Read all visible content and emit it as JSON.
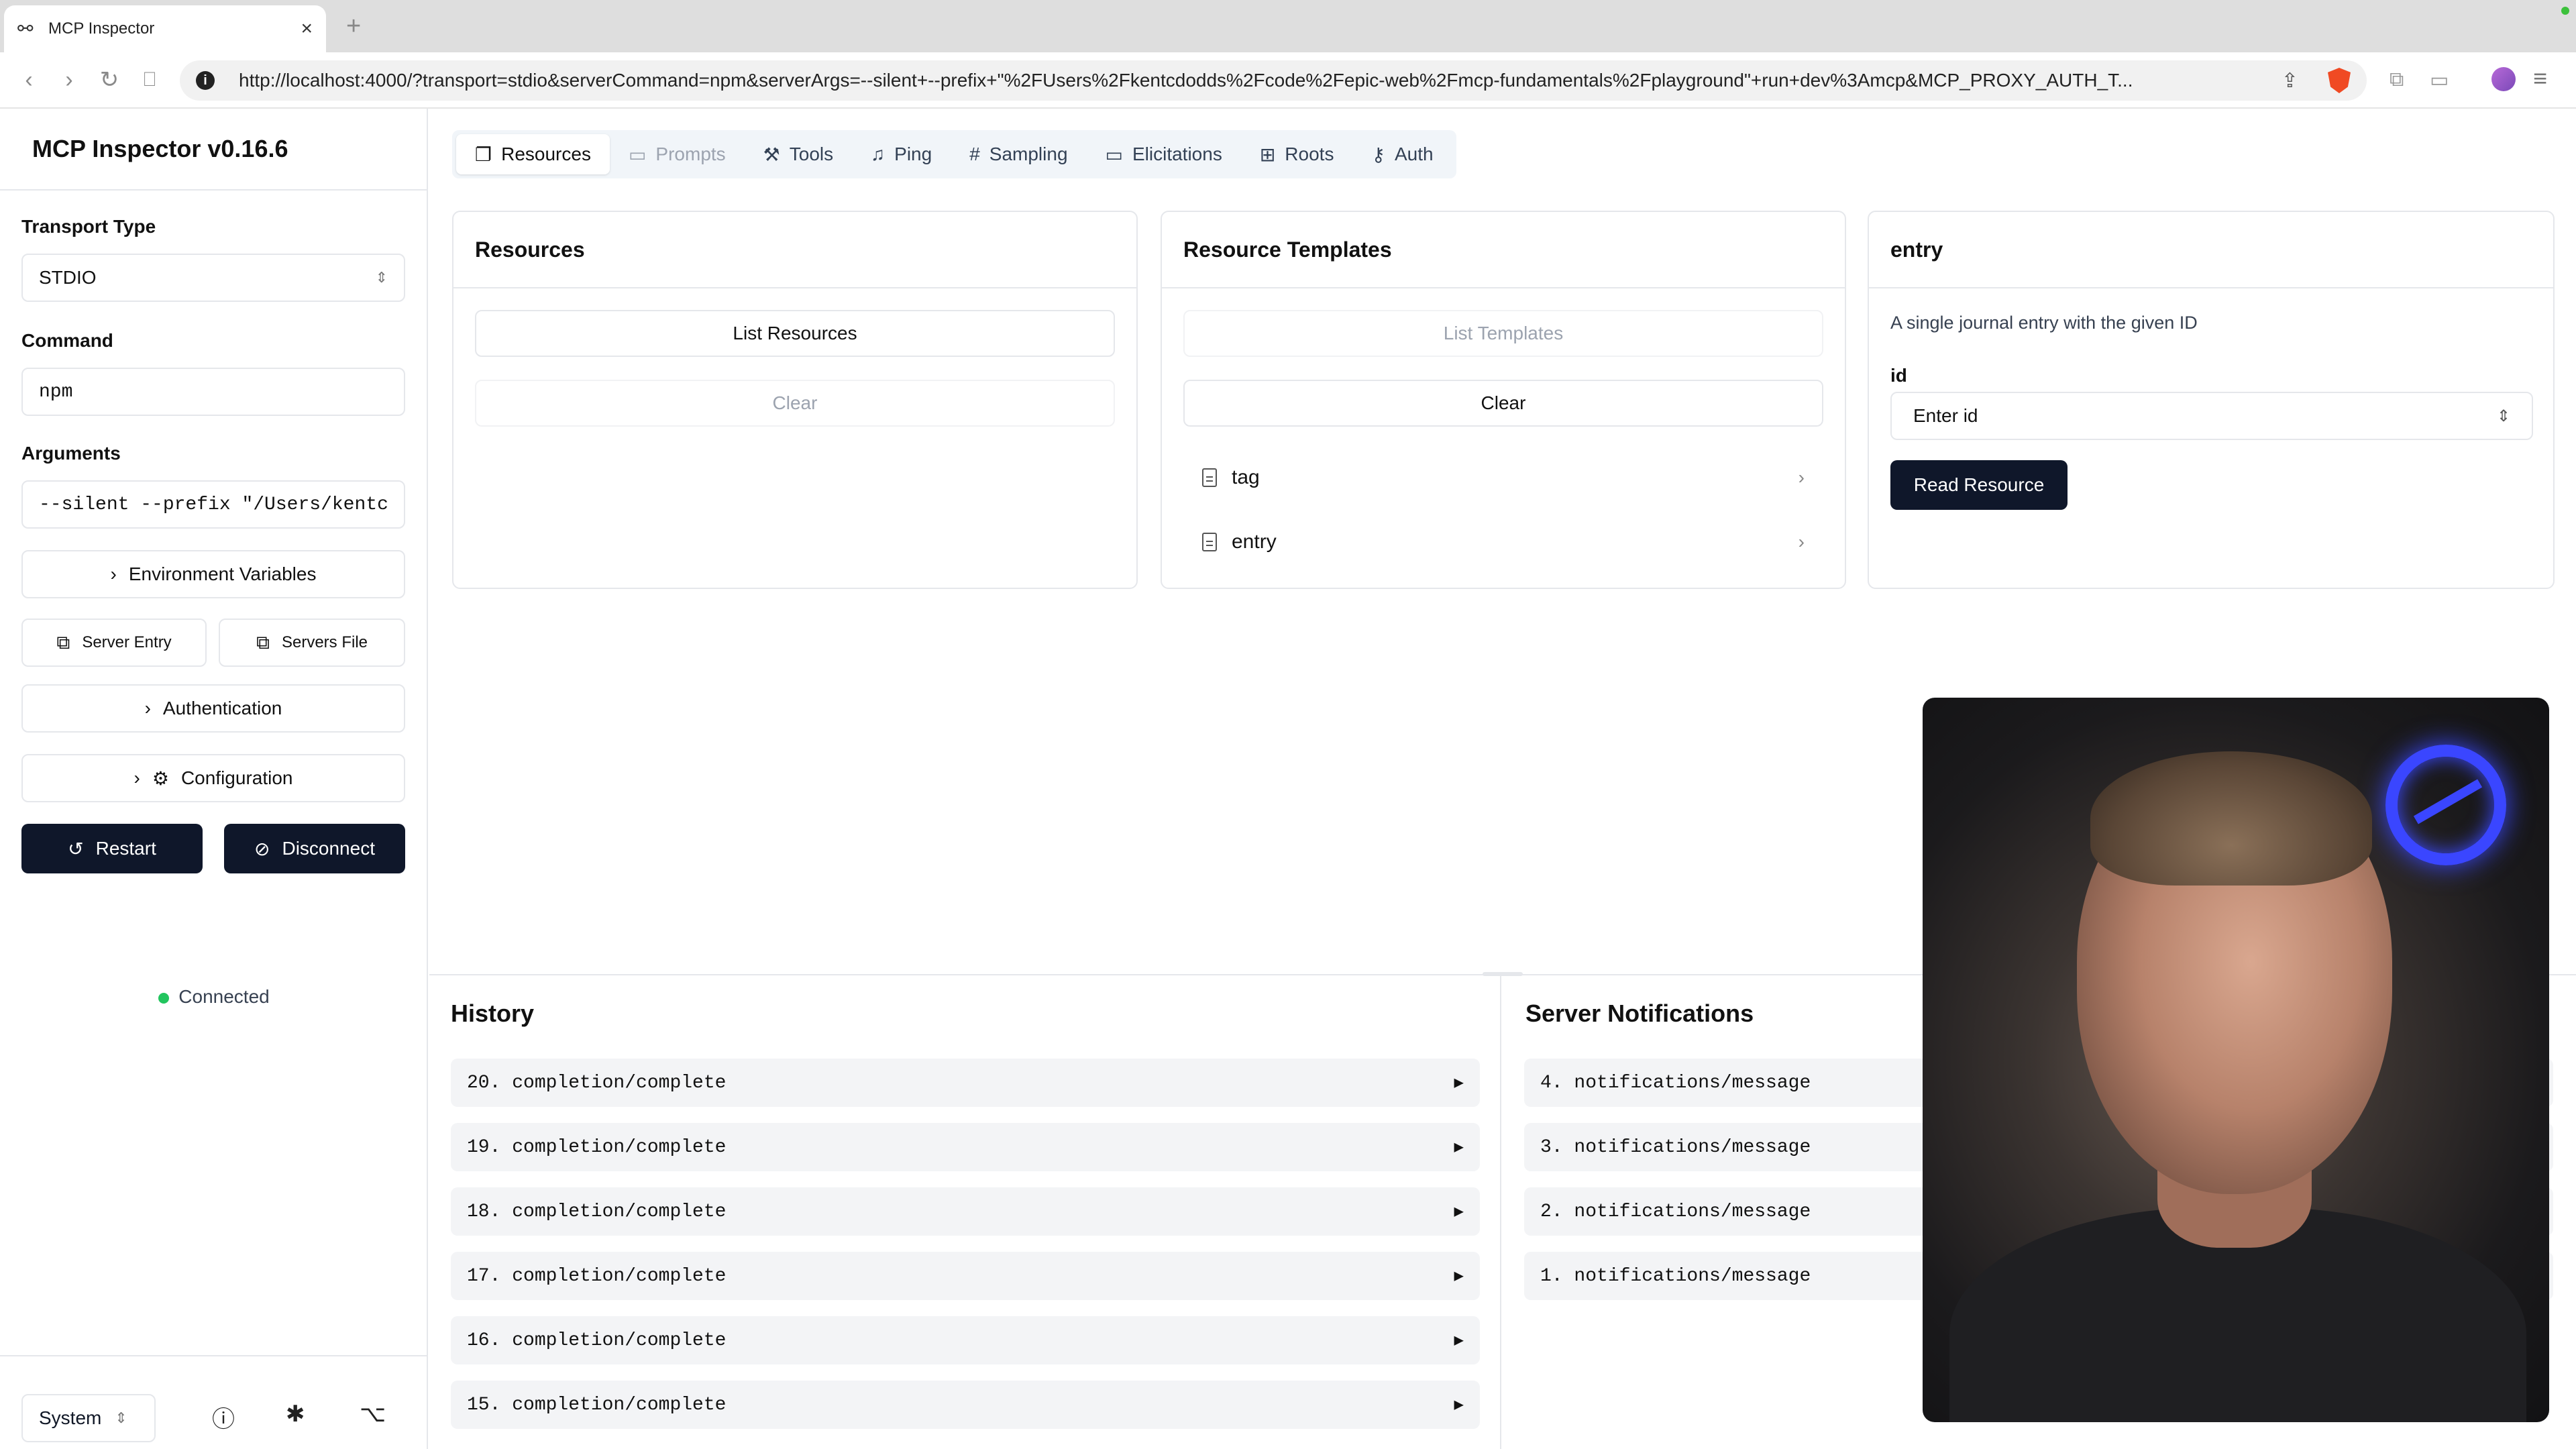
{
  "browser": {
    "tab_title": "MCP Inspector",
    "url": "http://localhost:4000/?transport=stdio&serverCommand=npm&serverArgs=--silent+--prefix+\"%2FUsers%2Fkentcdodds%2Fcode%2Fepic-web%2Fmcp-fundamentals%2Fplayground\"+run+dev%3Amcp&MCP_PROXY_AUTH_T..."
  },
  "sidebar": {
    "title": "MCP Inspector v0.16.6",
    "transport_label": "Transport Type",
    "transport_value": "STDIO",
    "command_label": "Command",
    "command_value": "npm",
    "arguments_label": "Arguments",
    "arguments_value": "--silent --prefix \"/Users/kentc",
    "env_vars": "Environment Variables",
    "server_entry": "Server Entry",
    "servers_file": "Servers File",
    "authentication": "Authentication",
    "configuration": "Configuration",
    "restart": "Restart",
    "disconnect": "Disconnect",
    "status": "Connected",
    "theme": "System"
  },
  "tabs": [
    {
      "label": "Resources",
      "icon": "files-icon"
    },
    {
      "label": "Prompts",
      "icon": "message-square-icon"
    },
    {
      "label": "Tools",
      "icon": "hammer-icon"
    },
    {
      "label": "Ping",
      "icon": "bell-icon"
    },
    {
      "label": "Sampling",
      "icon": "hash-icon"
    },
    {
      "label": "Elicitations",
      "icon": "message-square-icon"
    },
    {
      "label": "Roots",
      "icon": "folder-tree-icon"
    },
    {
      "label": "Auth",
      "icon": "key-icon"
    }
  ],
  "resources": {
    "title": "Resources",
    "list_button": "List Resources",
    "clear_button": "Clear"
  },
  "templates": {
    "title": "Resource Templates",
    "list_button": "List Templates",
    "clear_button": "Clear",
    "items": [
      "tag",
      "entry"
    ]
  },
  "entry": {
    "title": "entry",
    "description": "A single journal entry with the given ID",
    "field_label": "id",
    "field_placeholder": "Enter id",
    "read_button": "Read Resource"
  },
  "history": {
    "title": "History",
    "items": [
      "20. completion/complete",
      "19. completion/complete",
      "18. completion/complete",
      "17. completion/complete",
      "16. completion/complete",
      "15. completion/complete"
    ]
  },
  "notifications": {
    "title": "Server Notifications",
    "items": [
      "4. notifications/message",
      "3. notifications/message",
      "2. notifications/message",
      "1. notifications/message"
    ]
  },
  "colors": {
    "primary_dark": "#0f172a",
    "connected": "#22c55e",
    "border": "#e5e7eb"
  }
}
